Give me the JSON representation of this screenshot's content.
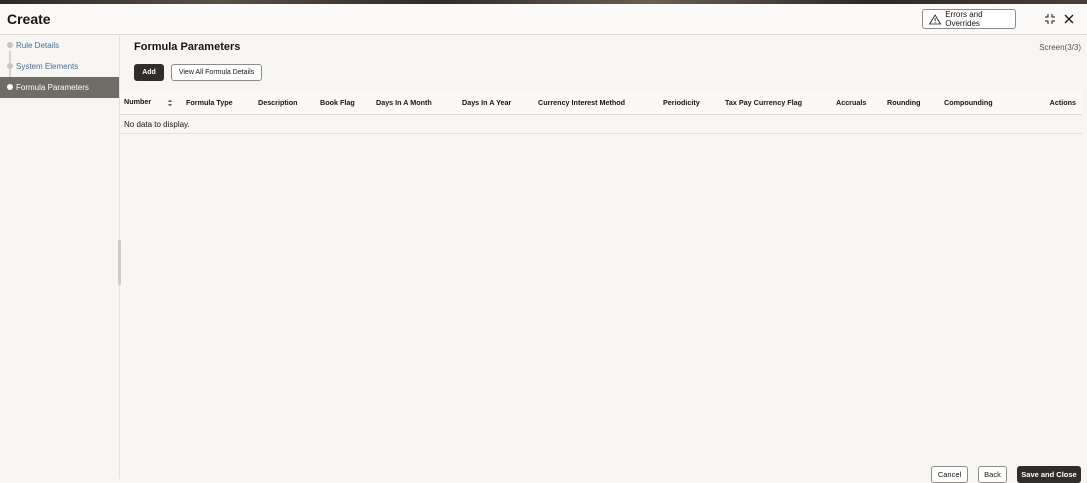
{
  "header": {
    "title": "Create",
    "errors_label": "Errors and Overrides"
  },
  "sidebar": {
    "items": [
      {
        "label": "Rule Details",
        "active": false
      },
      {
        "label": "System Elements",
        "active": false
      },
      {
        "label": "Formula Parameters",
        "active": true
      }
    ]
  },
  "main": {
    "title": "Formula Parameters",
    "screen_indicator": "Screen(3/3)",
    "add_label": "Add",
    "view_all_label": "View All Formula Details",
    "table": {
      "columns": [
        "Number",
        "Formula Type",
        "Description",
        "Book Flag",
        "Days In A Month",
        "Days In A Year",
        "Currency Interest Method",
        "Periodicity",
        "Tax Pay Currency Flag",
        "Accruals",
        "Rounding",
        "Compounding",
        "Actions"
      ],
      "empty_message": "No data to display."
    }
  },
  "footer": {
    "cancel_label": "Cancel",
    "back_label": "Back",
    "save_label": "Save and Close"
  },
  "icons": {
    "warning": "warning-triangle-icon",
    "resize": "resize-icon",
    "close": "close-icon",
    "sort": "sort-icon"
  }
}
